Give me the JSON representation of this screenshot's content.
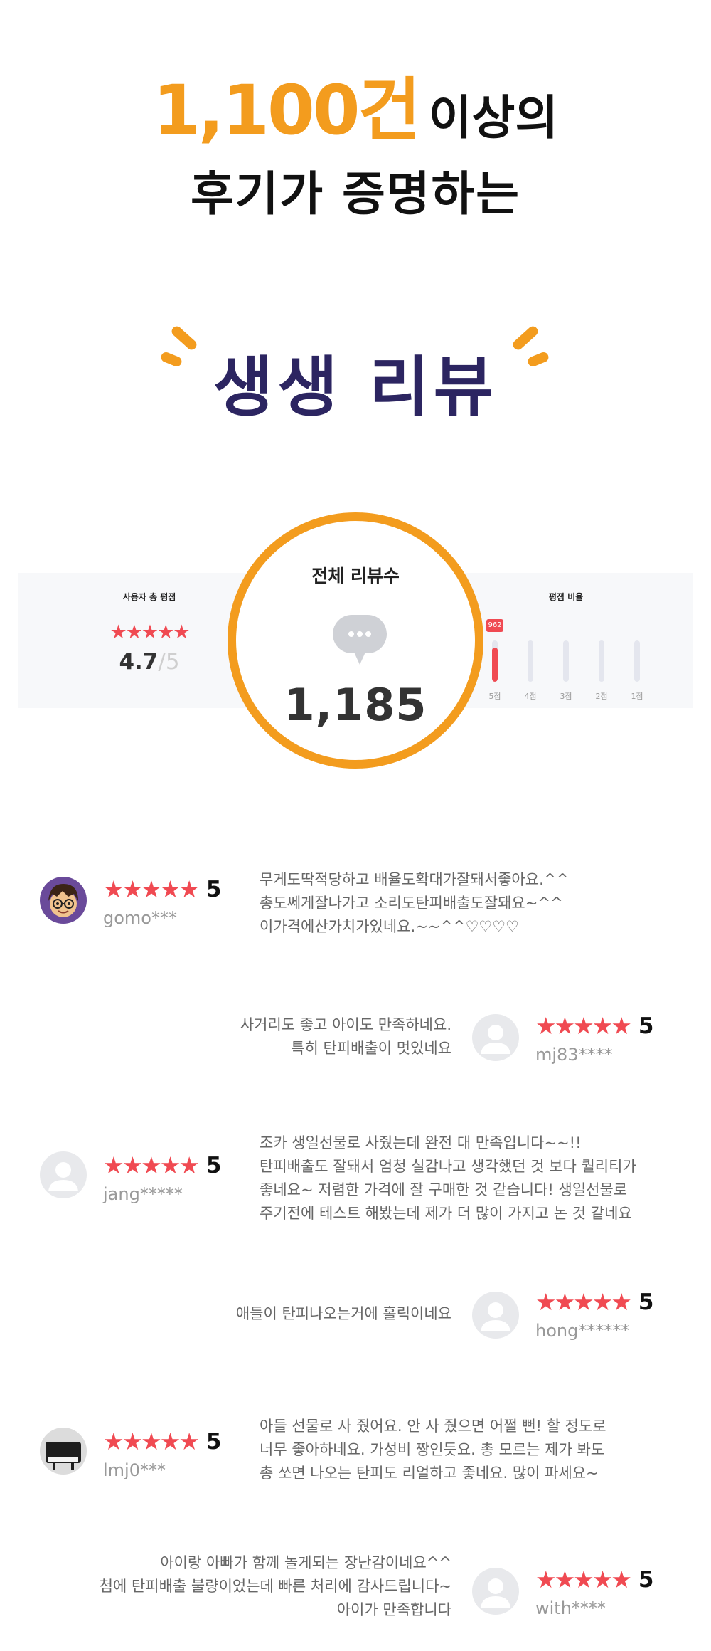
{
  "header": {
    "count": "1,100건",
    "suffix": "이상의",
    "line2": "후기가 증명하는",
    "title": "생생 리뷰"
  },
  "stats": {
    "avg_title": "사용자 총 평점",
    "avg_stars": "★★★★★",
    "avg_value": "4.7",
    "avg_max": "/5",
    "total_title": "전체 리뷰수",
    "total_count": "1,185",
    "ratio_title": "평점 비율",
    "ratio": [
      {
        "label": "5점",
        "count": "962",
        "fill": 0.82
      },
      {
        "label": "4점",
        "count": "",
        "fill": 0
      },
      {
        "label": "3점",
        "count": "",
        "fill": 0
      },
      {
        "label": "2점",
        "count": "",
        "fill": 0
      },
      {
        "label": "1점",
        "count": "",
        "fill": 0
      }
    ]
  },
  "reviews": [
    {
      "user": "gomo***",
      "stars": "★★★★★",
      "score": "5",
      "avatar": "cartoon-character",
      "text": "무게도딱적당하고 배율도확대가잘돼서좋아요.^^\n총도쎄게잘나가고 소리도탄피배출도잘돼요~^^\n이가격에산가치가있네요.~~^^♡♡♡♡"
    },
    {
      "user": "mj83****",
      "stars": "★★★★★",
      "score": "5",
      "avatar": "default",
      "text": "사거리도 좋고 아이도 만족하네요.\n특히 탄피배출이 멋있네요"
    },
    {
      "user": "jang*****",
      "stars": "★★★★★",
      "score": "5",
      "avatar": "default",
      "text": "조카 생일선물로 사줬는데 완전 대 만족입니다~~!!\n탄피배출도 잘돼서 엄청 실감나고 생각했던 것 보다 퀄리티가\n좋네요~ 저렴한 가격에 잘 구매한 것 같습니다! 생일선물로\n주기전에 테스트 해봤는데 제가 더 많이 가지고 논 것 같네요"
    },
    {
      "user": "hong******",
      "stars": "★★★★★",
      "score": "5",
      "avatar": "default",
      "text": "애들이 탄피나오는거에 홀릭이네요"
    },
    {
      "user": "lmj0***",
      "stars": "★★★★★",
      "score": "5",
      "avatar": "piano-photo",
      "text": "아들 선물로 사 줬어요. 안 사 줬으면 어쩔 뻔! 할 정도로\n너무 좋아하네요. 가성비 짱인듯요. 총 모르는 제가 봐도\n총 쏘면 나오는 탄피도 리얼하고 좋네요. 많이 파세요~"
    },
    {
      "user": "with****",
      "stars": "★★★★★",
      "score": "5",
      "avatar": "default",
      "text": "아이랑 아빠가 함께 놀게되는 장난감이네요^^\n첨에 탄피배출 불량이었는데 빠른 처리에 감사드립니다~\n아이가 만족합니다"
    }
  ]
}
